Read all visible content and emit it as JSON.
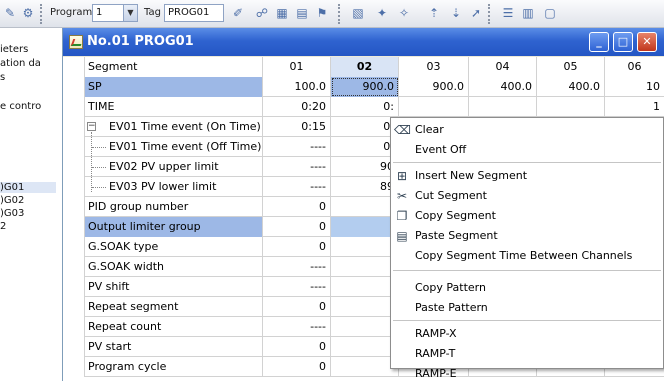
{
  "toolbar": {
    "program_label": "Program",
    "program_value": "1",
    "tag_label": "Tag",
    "tag_value": "PROG01"
  },
  "left_panel": {
    "items": [
      {
        "text": "ieters"
      },
      {
        "text": "ation da"
      },
      {
        "text": "s"
      },
      {
        "text": "e contro"
      },
      {
        "text": ")G01"
      },
      {
        "text": ")G02"
      },
      {
        "text": ")G03"
      },
      {
        "text": "2"
      }
    ]
  },
  "window": {
    "title": "No.01 PROG01",
    "minimize_symbol": "_",
    "maximize_symbol": "□",
    "close_symbol": "✕"
  },
  "grid": {
    "header": {
      "name": "Segment",
      "cols": [
        "01",
        "02",
        "03",
        "04",
        "05",
        "06"
      ]
    },
    "rows": [
      {
        "name": "SP",
        "values": [
          "100.0",
          "900.0",
          "900.0",
          "400.0",
          "400.0",
          "10"
        ]
      },
      {
        "name": "TIME",
        "values": [
          "0:20",
          "0:",
          "",
          "",
          "",
          "1"
        ]
      },
      {
        "name": "EV01 Time event (On Time)",
        "values": [
          "0:15",
          "0:",
          "",
          "",
          "",
          ""
        ]
      },
      {
        "name": "EV01 Time event (Off Time)",
        "values": [
          "----",
          "0:",
          "",
          "",
          "",
          ""
        ]
      },
      {
        "name": "EV02 PV upper limit",
        "values": [
          "----",
          "90",
          "",
          "",
          "",
          ""
        ]
      },
      {
        "name": "EV03 PV lower limit",
        "values": [
          "----",
          "89",
          "",
          "",
          "",
          "C"
        ]
      },
      {
        "name": "PID group number",
        "values": [
          "0",
          "",
          "",
          "",
          "",
          ""
        ]
      },
      {
        "name": "Output limiter group",
        "values": [
          "0",
          "",
          "",
          "",
          "",
          ""
        ]
      },
      {
        "name": "G.SOAK type",
        "values": [
          "0",
          "",
          "",
          "",
          "",
          ""
        ]
      },
      {
        "name": "G.SOAK width",
        "values": [
          "----",
          "",
          "",
          "",
          "",
          ""
        ]
      },
      {
        "name": "PV shift",
        "values": [
          "----",
          "",
          "",
          "",
          "",
          ""
        ]
      },
      {
        "name": "Repeat segment",
        "values": [
          "0",
          "",
          "",
          "",
          "",
          ""
        ]
      },
      {
        "name": "Repeat count",
        "values": [
          "----",
          "",
          "",
          "",
          "",
          ""
        ]
      },
      {
        "name": "PV start",
        "values": [
          "0",
          "",
          "",
          "",
          "",
          ""
        ]
      },
      {
        "name": "Program cycle",
        "values": [
          "0",
          "",
          "",
          "",
          "",
          ""
        ]
      }
    ]
  },
  "context_menu": {
    "items": [
      {
        "label": "Clear",
        "icon": "eraser-icon"
      },
      {
        "label": "Event Off",
        "icon": ""
      },
      {
        "label": "Insert New Segment",
        "icon": "insert-icon"
      },
      {
        "label": "Cut Segment",
        "icon": "scissors-icon"
      },
      {
        "label": "Copy Segment",
        "icon": "copy-icon"
      },
      {
        "label": "Paste Segment",
        "icon": "paste-icon"
      },
      {
        "label": "Copy Segment Time Between Channels",
        "icon": ""
      },
      {
        "label": "Copy Pattern",
        "icon": ""
      },
      {
        "label": "Paste Pattern",
        "icon": ""
      },
      {
        "label": "RAMP-X",
        "icon": ""
      },
      {
        "label": "RAMP-T",
        "icon": ""
      },
      {
        "label": "RAMP-E",
        "icon": ""
      }
    ]
  },
  "colors": {
    "title_bar": "#2f63d0",
    "selection": "#9db8e6",
    "grid_line": "#d2d2d2"
  }
}
